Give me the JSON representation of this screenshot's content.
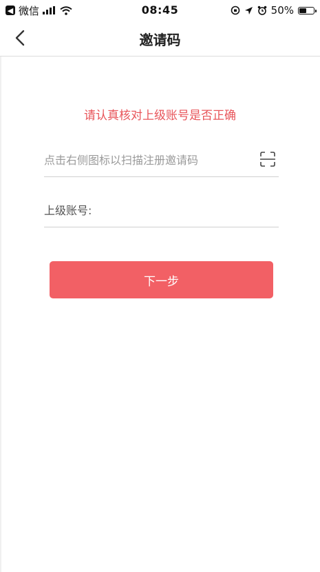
{
  "status_bar": {
    "back_app": "微信",
    "time": "08:45",
    "battery_percent": "50%",
    "battery_level": 0.5
  },
  "nav": {
    "title": "邀请码"
  },
  "notice": {
    "text": "请认真核对上级账号是否正确"
  },
  "form": {
    "invite_code_placeholder": "点击右侧图标以扫描注册邀请码",
    "invite_code_value": "",
    "parent_account_label": "上级账号:",
    "parent_account_value": ""
  },
  "actions": {
    "next_label": "下一步"
  },
  "colors": {
    "accent": "#f26065",
    "notice": "#e8555a"
  },
  "icons": {
    "back": "chevron-left-icon",
    "scan": "scan-icon"
  }
}
